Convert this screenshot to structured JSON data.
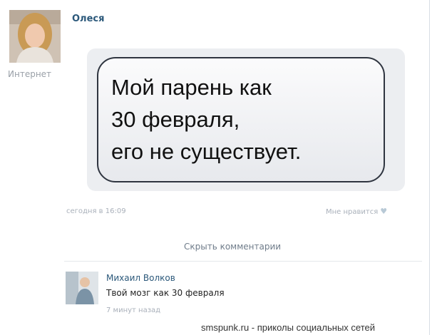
{
  "post": {
    "author": "Олеся",
    "status": "Интернет",
    "message_lines": [
      "Мой парень как",
      "30 февраля,",
      "его не существует."
    ],
    "time": "сегодня в 16:09",
    "like_label": "Мне нравится"
  },
  "comments": {
    "toggle_label": "Скрыть комментарии",
    "items": [
      {
        "author": "Михаил Волков",
        "text": "Твой мозг как 30 февраля",
        "time": "7 минут назад"
      }
    ]
  },
  "footer": {
    "watermark": "smspunk.ru - приколы социальных сетей"
  },
  "icons": {
    "avatar": "user-photo",
    "like": "heart-icon",
    "comment_avatar": "user-photo"
  },
  "colors": {
    "link": "#2b587a",
    "muted": "#a9b0ba",
    "bubble_border": "#2f3540"
  }
}
